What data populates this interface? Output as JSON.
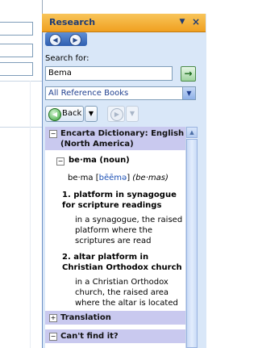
{
  "pane": {
    "title": "Research",
    "dropdown_icon": "▼",
    "close_icon": "×",
    "back_nav_icon": "◀",
    "forward_nav_icon": "▶"
  },
  "search": {
    "label": "Search for:",
    "value": "Bema",
    "go_icon": "→",
    "reference_select": "All Reference Books",
    "select_arrow": "▼"
  },
  "toolbar": {
    "back_label": "Back",
    "back_dropdown": "▼",
    "forward_dropdown": "▼"
  },
  "results": {
    "section_title_line1": "Encarta Dictionary: English",
    "section_title_line2": "(North America)",
    "entry_head": "be·ma (noun)",
    "pron_word": "be·ma",
    "pron_open": "[",
    "pron_phonetic": "bēēmə",
    "pron_close": "]",
    "plural": "(be·mas)",
    "def1_line1": "1. platform in synagogue",
    "def1_line2": "for scripture readings",
    "def1_text_line1": "in a synagogue, the raised",
    "def1_text_line2": "platform where the",
    "def1_text_line3": "scriptures are read",
    "def2_line1": "2. altar platform in",
    "def2_line2": "Christian Orthodox church",
    "def2_text_line1": "in a Christian Orthodox",
    "def2_text_line2": "church, the raised area",
    "def2_text_line3": "where the altar is located",
    "translation_title": "Translation",
    "cantfind_title": "Can't find it?",
    "collapse_glyph": "−",
    "expand_glyph": "+"
  },
  "colors": {
    "header": "#f0a020",
    "pane_bg": "#d9e7f8",
    "section_bg": "#c9c9ef"
  }
}
